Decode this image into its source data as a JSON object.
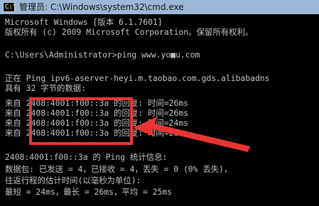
{
  "window": {
    "title": "管理员: C:\\Windows\\system32\\cmd.exe",
    "icon": "cmd-icon",
    "icon_glyph": "C:\\"
  },
  "console": {
    "lines": [
      "Microsoft Windows [版本 6.1.7601]",
      "版权所有 (c) 2009 Microsoft Corporation。保留所有权利。",
      "",
      "C:\\Users\\Administrator>ping www.yo■u.com",
      "",
      "正在 Ping ipv6-aserver-heyi.m.taobao.com.gds.alibabadns",
      "具有 32 字节的数据:",
      "来自 2408:4001:f00::3a 的回复: 时间=26ms",
      "来自 2408:4001:f00::3a 的回复: 时间=26ms",
      "来自 2408:4001:f00::3a 的回复: 时间=24ms",
      "来自 2408:4001:f00::3a 的回复: 时间=26ms",
      "",
      "2408:4001:f00::3a 的 Ping 统计信息:",
      "    数据包: 已发送 = 4，已接收 = 4，丢失 = 0 (0% 丢失)，",
      "往返行程的估计时间(以毫秒为单位):",
      "    最短 = 24ms，最长 = 26ms，平均 = 25ms"
    ]
  },
  "annotation": {
    "highlight_color": "#e93434",
    "arrow_color": "#e93434"
  },
  "colors": {
    "console_bg": "#000000",
    "console_text": "#c0c0c0",
    "titlebar_bg": "#9db7d7"
  }
}
